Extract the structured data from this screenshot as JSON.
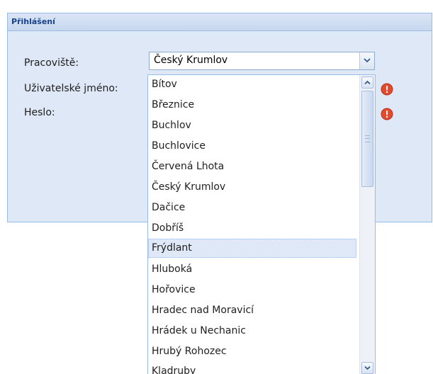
{
  "panel": {
    "title": "Přihlášení"
  },
  "form": {
    "workplace_label": "Pracoviště:",
    "username_label": "Uživatelské jméno:",
    "password_label": "Heslo:",
    "workplace_value": "Český Krumlov"
  },
  "dropdown": {
    "items": [
      "Bítov",
      "Březnice",
      "Buchlov",
      "Buchlovice",
      "Červená Lhota",
      "Český Krumlov",
      "Dačice",
      "Dobříš",
      "Frýdlant",
      "Hluboká",
      "Hořovice",
      "Hradec nad Moravicí",
      "Hrádek u Nechanic",
      "Hrubý Rohozec",
      "Kladruby"
    ],
    "highlighted_item": "Frýdlant"
  },
  "icons": {
    "combo_trigger": "chevron-down-icon",
    "field_error": "error-icon",
    "scroll_up": "chevron-up-icon",
    "scroll_down": "chevron-down-icon"
  },
  "colors": {
    "header_text": "#15428b",
    "panel_border": "#99bbe8",
    "panel_background": "#dfe8f6",
    "error_red": "#e34b2e",
    "selection_background": "#dfe8f6"
  }
}
